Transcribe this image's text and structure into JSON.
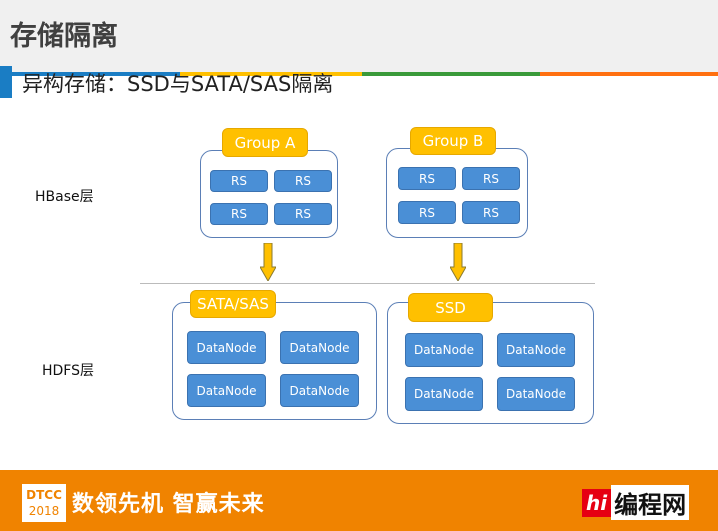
{
  "header": {
    "title": "存储隔离",
    "subtitle": "异构存储：SSD与SATA/SAS隔离"
  },
  "colors": {
    "stripes": [
      "#1a7dc4",
      "#ffc000",
      "#3a9a3a",
      "#ff7010"
    ],
    "accent": "#ffc000",
    "node": "#4a8fd6",
    "footer": "#f08300"
  },
  "diagram": {
    "layers": {
      "hbase": "HBase层",
      "hdfs": "HDFS层"
    },
    "groups": [
      {
        "label": "Group A",
        "nodes": [
          "RS",
          "RS",
          "RS",
          "RS"
        ]
      },
      {
        "label": "Group B",
        "nodes": [
          "RS",
          "RS",
          "RS",
          "RS"
        ]
      },
      {
        "label": "SATA/SAS",
        "nodes": [
          "DataNode",
          "DataNode",
          "DataNode",
          "DataNode"
        ]
      },
      {
        "label": "SSD",
        "nodes": [
          "DataNode",
          "DataNode",
          "DataNode",
          "DataNode"
        ]
      }
    ]
  },
  "footer": {
    "logo_line1": "DTCC",
    "logo_line2": "2018",
    "slogan": "数领先机 智赢未来",
    "brand_hi": "hi",
    "brand_name": "编程网"
  }
}
